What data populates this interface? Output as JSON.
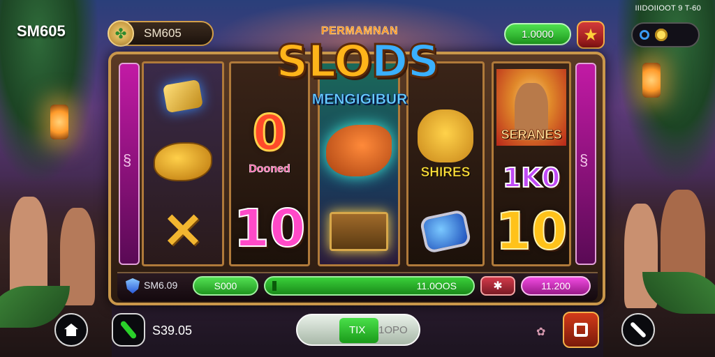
{
  "header": {
    "brand": "SM605",
    "account_pill": "SM605",
    "status_text": "IIIDOIIOOT 9 T-60",
    "balance": "1.0000",
    "star_icon": "star-icon",
    "toggle_icons": [
      "ring-icon",
      "sun-icon"
    ]
  },
  "logo": {
    "top": "PERMAMNAN",
    "main_part1": "SLO",
    "main_part2": "DS",
    "sub": "MENGIGIBUR"
  },
  "reels": {
    "r2": {
      "word": "Dooned",
      "num": "10",
      "top_num": "0"
    },
    "r4": {
      "word": "SHIRES"
    },
    "r5": {
      "word": "SERANES",
      "num1k": "1K0",
      "num": "10"
    }
  },
  "bet_bar": {
    "id": "SM6.09",
    "bet": "S000",
    "progress_value": "11.0OOS",
    "progress_fraction": 0.02,
    "total": "11.200"
  },
  "bottom": {
    "amount": "S39.05",
    "spin_label1": "TIX",
    "spin_label2": "1OPO"
  },
  "colors": {
    "accent_green": "#2ad02a",
    "accent_gold": "#c9974a",
    "accent_magenta": "#f04ae0",
    "accent_red": "#d23a1a"
  }
}
